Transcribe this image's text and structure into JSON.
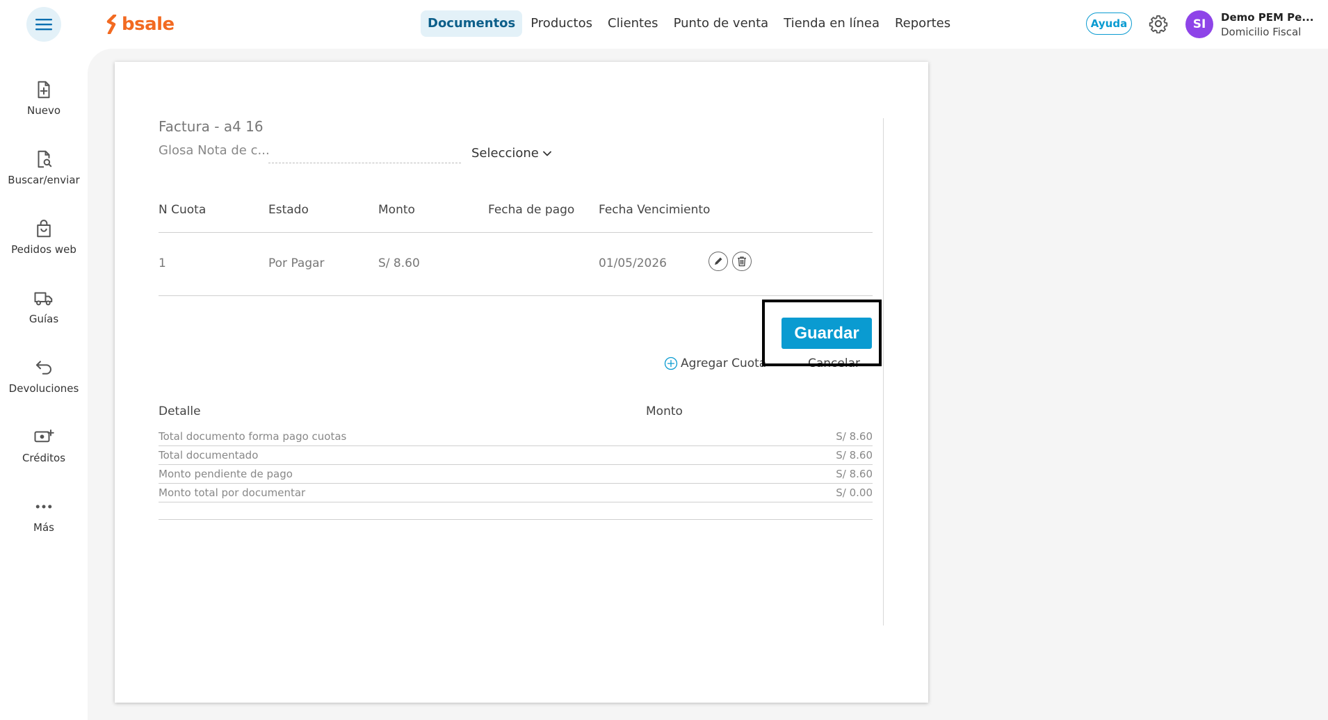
{
  "brand": {
    "name": "bsale"
  },
  "nav": {
    "items": [
      {
        "label": "Documentos",
        "active": true
      },
      {
        "label": "Productos"
      },
      {
        "label": "Clientes"
      },
      {
        "label": "Punto de venta"
      },
      {
        "label": "Tienda en línea"
      },
      {
        "label": "Reportes"
      }
    ]
  },
  "header": {
    "help_label": "Ayuda",
    "avatar_initials": "SI",
    "user_name": "Demo PEM Pe...",
    "user_sub": "Domicilio Fiscal"
  },
  "sidebar": {
    "items": [
      {
        "label": "Nuevo",
        "icon": "file-plus-icon"
      },
      {
        "label": "Buscar/enviar",
        "icon": "file-search-icon"
      },
      {
        "label": "Pedidos web",
        "icon": "shopping-bag-icon"
      },
      {
        "label": "Guías",
        "icon": "truck-icon"
      },
      {
        "label": "Devoluciones",
        "icon": "return-arrow-icon"
      },
      {
        "label": "Créditos",
        "icon": "cash-plus-icon"
      },
      {
        "label": "Más",
        "icon": "more-dots-icon"
      }
    ]
  },
  "form": {
    "title": "Factura - a4 16",
    "glosa_label": "Glosa Nota de c...",
    "glosa_value": "",
    "select_label": "Seleccione"
  },
  "table": {
    "headers": [
      "N Cuota",
      "Estado",
      "Monto",
      "Fecha de pago",
      "Fecha Vencimiento"
    ],
    "rows": [
      {
        "n": "1",
        "estado": "Por Pagar",
        "monto": "S/ 8.60",
        "fecha_pago": "",
        "vencimiento": "01/05/2026"
      }
    ]
  },
  "actions": {
    "save_label": "Guardar",
    "add_label": "Agregar Cuota",
    "cancel_label": "Cancelar"
  },
  "detail": {
    "headers": {
      "detalle": "Detalle",
      "monto": "Monto"
    },
    "rows": [
      {
        "label": "Total documento forma pago cuotas",
        "value": "S/ 8.60"
      },
      {
        "label": "Total documentado",
        "value": "S/ 8.60"
      },
      {
        "label": "Monto pendiente de pago",
        "value": "S/ 8.60"
      },
      {
        "label": "Monto total por documentar",
        "value": "S/ 0.00"
      }
    ]
  },
  "colors": {
    "brand": "#f26a21",
    "accent": "#0a9bd1",
    "nav_active_bg": "#e3f1f8",
    "avatar": "#8e44e8"
  }
}
